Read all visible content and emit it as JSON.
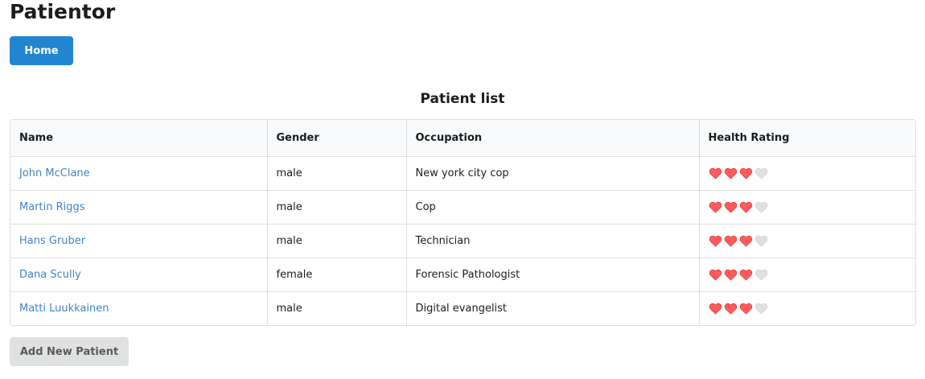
{
  "app": {
    "title": "Patientor"
  },
  "nav": {
    "home_label": "Home"
  },
  "patient_list": {
    "title": "Patient list",
    "columns": [
      "Name",
      "Gender",
      "Occupation",
      "Health Rating"
    ],
    "rows": [
      {
        "name": "John McClane",
        "gender": "male",
        "occupation": "New york city cop",
        "health_rating": 3,
        "max_rating": 4
      },
      {
        "name": "Martin Riggs",
        "gender": "male",
        "occupation": "Cop",
        "health_rating": 3,
        "max_rating": 4
      },
      {
        "name": "Hans Gruber",
        "gender": "male",
        "occupation": "Technician",
        "health_rating": 3,
        "max_rating": 4
      },
      {
        "name": "Dana Scully",
        "gender": "female",
        "occupation": "Forensic Pathologist",
        "health_rating": 3,
        "max_rating": 4
      },
      {
        "name": "Matti Luukkainen",
        "gender": "male",
        "occupation": "Digital evangelist",
        "health_rating": 3,
        "max_rating": 4
      }
    ]
  },
  "actions": {
    "add_label": "Add New Patient"
  },
  "colors": {
    "primary": "#2185d0",
    "link": "#4183c4",
    "heart_filled": "#ff5b5b",
    "heart_empty": "#e0e0e0",
    "secondary_button": "#e0e1e2"
  },
  "icons": {
    "heart": "heart-icon"
  }
}
